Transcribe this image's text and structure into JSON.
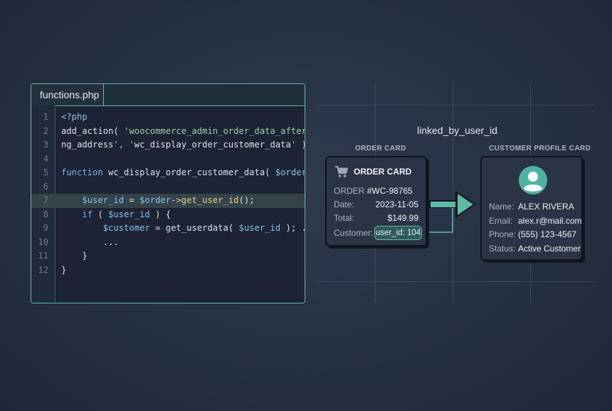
{
  "editor": {
    "tab_label": "functions.php",
    "lines": [
      {
        "num": "1",
        "text": "<?php"
      },
      {
        "num": "2",
        "text": "add_action( 'woocommerce_admin_order_data_after_billi"
      },
      {
        "num": "3",
        "text": "ng_address', 'wc_display_order_customer_data' );"
      },
      {
        "num": "4",
        "text": ""
      },
      {
        "num": "5",
        "text": "function wc_display_order_customer_data( $order ) {"
      },
      {
        "num": "6",
        "text": ""
      },
      {
        "num": "7",
        "text": "    $user_id = $order->get_user_id();"
      },
      {
        "num": "8",
        "text": "    if ( $user_id ) {"
      },
      {
        "num": "9",
        "text": "        $customer = get_userdata( $user_id ); ..."
      },
      {
        "num": "10",
        "text": "        ..."
      },
      {
        "num": "11",
        "text": "    }"
      },
      {
        "num": "12",
        "text": "}"
      }
    ],
    "highlighted_line": "7"
  },
  "diagram": {
    "caption": "linked_by_user_id",
    "order_card": {
      "section_label": "ORDER CARD",
      "title": "ORDER CARD",
      "icon": "cart-icon",
      "order_prefix": "ORDER",
      "order_number": "#WC-98765",
      "date_label": "Date:",
      "date": "2023-11-05",
      "total_label": "Total:",
      "total": "$149.99",
      "customer_label": "Customer:",
      "customer_ref": "user_id: 104"
    },
    "profile_card": {
      "section_label": "CUSTOMER PROFILE CARD",
      "icon": "avatar-icon",
      "name_label": "Name:",
      "name": "ALEX RIVERA",
      "email_label": "Email:",
      "email": "alex.r@mail.com",
      "phone_label": "Phone:",
      "phone": "(555) 123-4567",
      "status_label": "Status:",
      "status": "Active Customer"
    }
  },
  "colors": {
    "accent": "#5fb9a9",
    "background": "#263043",
    "card": "#2a3446",
    "editor_bg": "#1b2334"
  }
}
